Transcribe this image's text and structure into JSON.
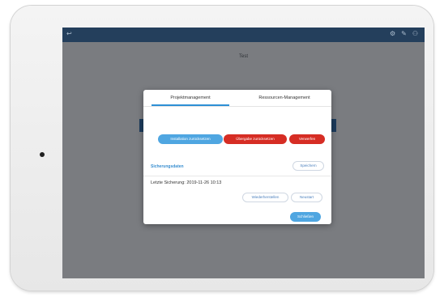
{
  "app_bar": {
    "back_glyph": "↩",
    "icons": [
      {
        "name": "settings-icon",
        "glyph": "⚙"
      },
      {
        "name": "tool-icon",
        "glyph": "✎"
      },
      {
        "name": "user-icon",
        "glyph": "⚇"
      }
    ]
  },
  "screen": {
    "title": "Test"
  },
  "dialog": {
    "tabs": [
      {
        "label": "Projektmanagement",
        "active": true
      },
      {
        "label": "Ressourcen-Management",
        "active": false
      }
    ],
    "actions": {
      "install": "Installation zurücksetzen",
      "handover": "Übergabe zurücksetzen",
      "discard": "Verwerfen"
    },
    "backup": {
      "section_title": "Sicherungsdaten",
      "save_label": "Speichern",
      "last_backup": "Letzte Sicherung: 2019-11-26 10:13",
      "restore_label": "Wiederherstellen",
      "reset_label": "Neustart"
    },
    "close_label": "Schließen"
  },
  "colors": {
    "app_bar": "#243f5c",
    "accent_blue": "#4fa6e1",
    "danger_red": "#d62d24",
    "screen_bg": "#7a7c80"
  }
}
